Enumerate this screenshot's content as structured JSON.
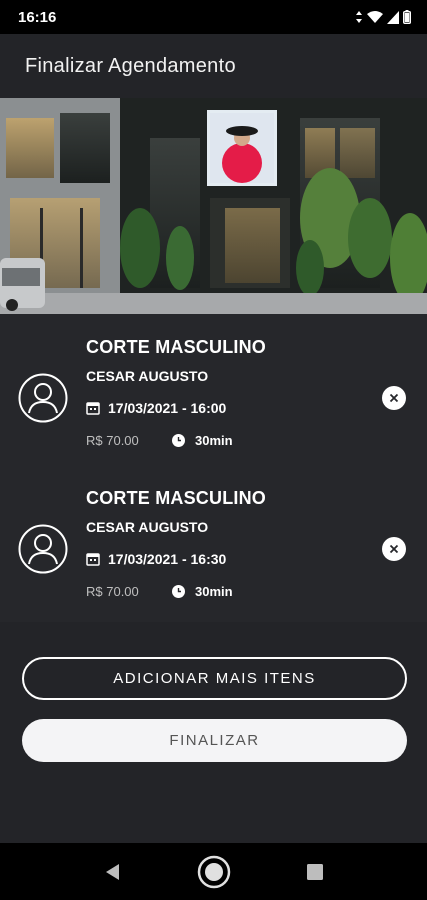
{
  "status_bar": {
    "time": "16:16"
  },
  "app_bar": {
    "title": "Finalizar Agendamento"
  },
  "cart": {
    "items": [
      {
        "service": "CORTE MASCULINO",
        "professional": "CESAR AUGUSTO",
        "datetime": "17/03/2021 - 16:00",
        "price": "R$ 70.00",
        "duration": "30min"
      },
      {
        "service": "CORTE MASCULINO",
        "professional": "CESAR AUGUSTO",
        "datetime": "17/03/2021 - 16:30",
        "price": "R$ 70.00",
        "duration": "30min"
      }
    ]
  },
  "actions": {
    "add_more": "ADICIONAR MAIS ITENS",
    "finish": "FINALIZAR"
  },
  "icons": {
    "status": [
      "data-saver-icon",
      "wifi-icon",
      "signal-icon",
      "battery-icon"
    ],
    "item": [
      "user-avatar-icon",
      "calendar-icon",
      "clock-icon",
      "remove-icon"
    ],
    "nav": [
      "back-icon",
      "home-icon",
      "recents-icon"
    ]
  },
  "colors": {
    "background": "#232428",
    "list_background": "#26272b",
    "button_filled": "#f4f4f6",
    "accent": "#ffffff"
  }
}
